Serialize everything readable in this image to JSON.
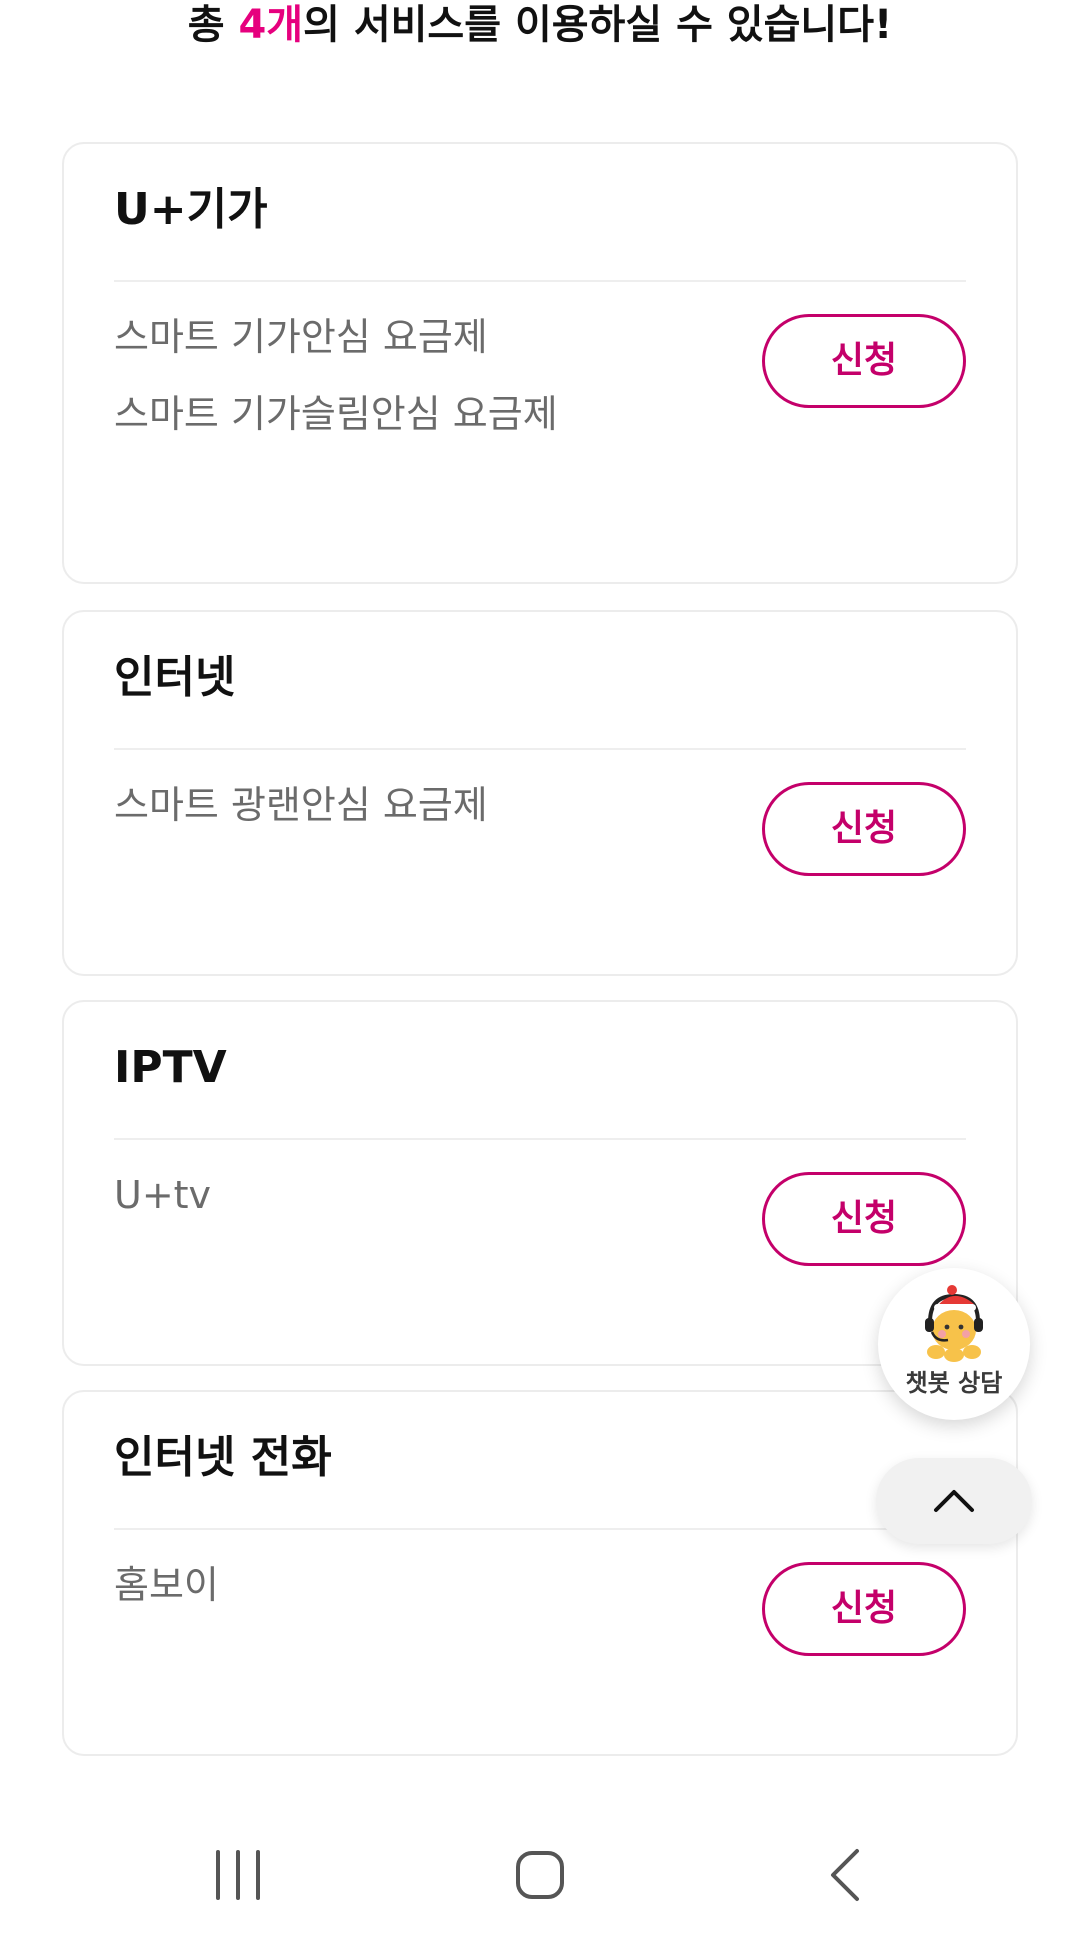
{
  "headline": {
    "prefix": "총 ",
    "count": "4개",
    "suffix": "의 서비스를 이용하실 수 있습니다!"
  },
  "accent_color": "#e6007e",
  "button_color": "#c4006a",
  "services": [
    {
      "title": "U+기가",
      "plans": [
        "스마트 기가안심 요금제",
        "스마트 기가슬림안심 요금제"
      ],
      "button_label": "신청"
    },
    {
      "title": "인터넷",
      "plans": [
        "스마트 광랜안심 요금제"
      ],
      "button_label": "신청"
    },
    {
      "title": "IPTV",
      "plans": [
        "U+tv"
      ],
      "button_label": "신청"
    },
    {
      "title": "인터넷 전화",
      "plans": [
        "홈보이"
      ],
      "button_label": "신청"
    }
  ],
  "chatbot": {
    "label": "챗봇 상담",
    "icon": "chatbot-character-icon"
  },
  "scroll_top": {
    "icon": "chevron-up-icon"
  },
  "system_nav": {
    "recent_icon": "recent-apps-icon",
    "home_icon": "home-icon",
    "back_icon": "back-icon"
  }
}
